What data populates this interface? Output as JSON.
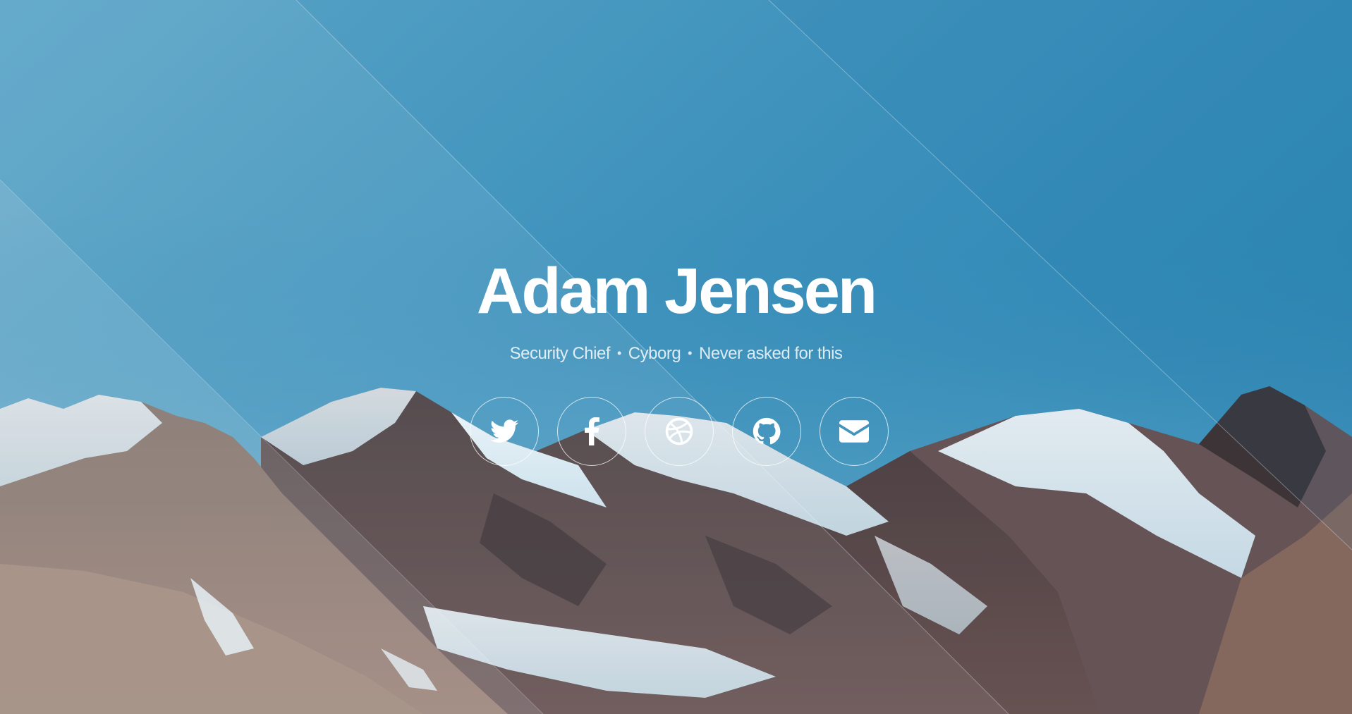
{
  "profile": {
    "name": "Adam Jensen",
    "tagline": [
      "Security Chief",
      "Cyborg",
      "Never asked for this"
    ],
    "separator": "•"
  },
  "social": [
    {
      "icon": "twitter-icon",
      "label": "Twitter"
    },
    {
      "icon": "facebook-icon",
      "label": "Facebook"
    },
    {
      "icon": "dribbble-icon",
      "label": "Dribbble"
    },
    {
      "icon": "github-icon",
      "label": "GitHub"
    },
    {
      "icon": "email-icon",
      "label": "Email"
    }
  ],
  "colors": {
    "sky": "#2f88b3",
    "accent": "#ffffff"
  }
}
